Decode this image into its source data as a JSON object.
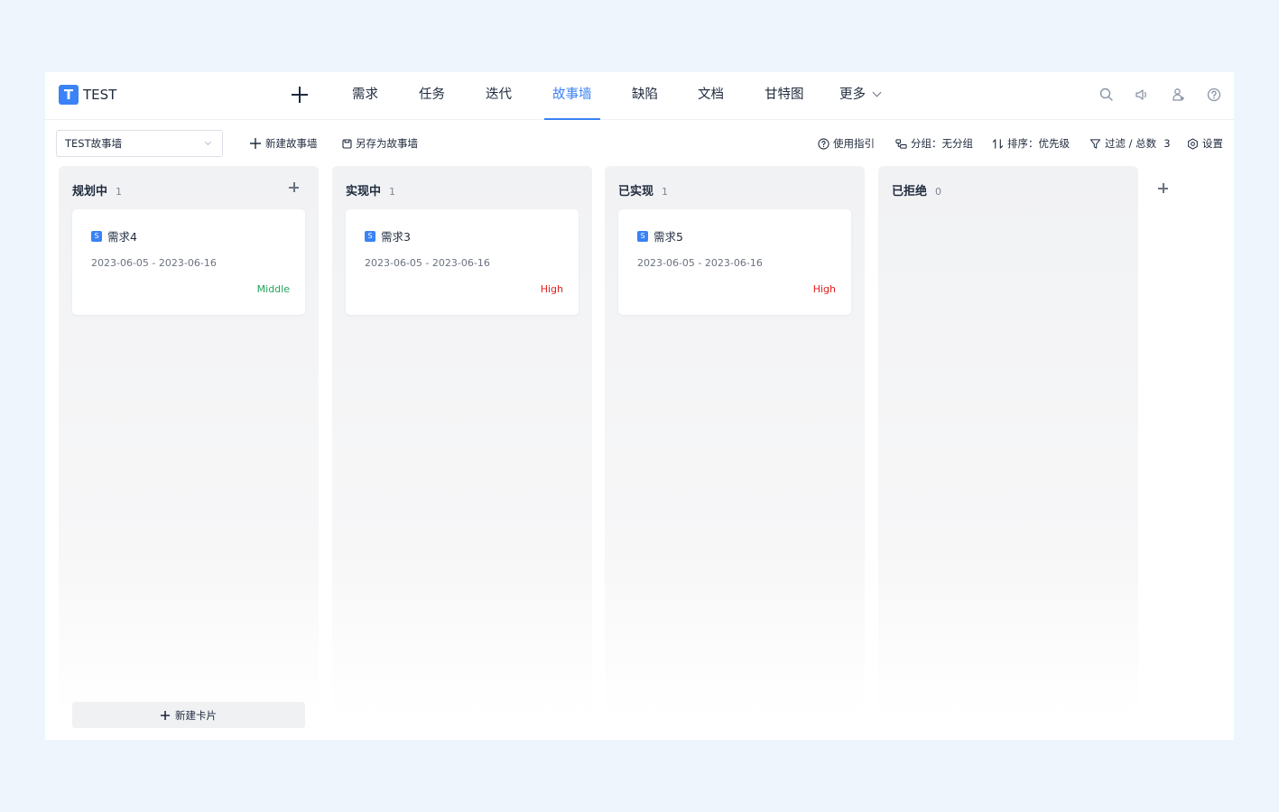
{
  "logo": {
    "letter": "T",
    "name": "TEST"
  },
  "nav": {
    "tabs": [
      {
        "label": "需求"
      },
      {
        "label": "任务"
      },
      {
        "label": "迭代"
      },
      {
        "label": "故事墙",
        "active": true
      },
      {
        "label": "缺陷"
      },
      {
        "label": "文档"
      },
      {
        "label": "甘特图"
      },
      {
        "label": "更多"
      }
    ],
    "icons": [
      "search-icon",
      "speaker-icon",
      "user-add-icon",
      "help-icon"
    ]
  },
  "toolbar": {
    "board_select": "TEST故事墙",
    "new_board": "新建故事墙",
    "save_as": "另存为故事墙",
    "guide": "使用指引",
    "group": "分组：无分组",
    "sort": "排序：优先级",
    "filter": "过滤 / 总数",
    "filter_count": "3",
    "settings": "设置"
  },
  "columns": [
    {
      "title": "规划中",
      "count": "1",
      "cards": [
        {
          "badge": "S",
          "title": "需求4",
          "dates": "2023-06-05 - 2023-06-16",
          "priority": "Middle",
          "priority_color": "#22a35a"
        }
      ]
    },
    {
      "title": "实现中",
      "count": "1",
      "cards": [
        {
          "badge": "S",
          "title": "需求3",
          "dates": "2023-06-05 - 2023-06-16",
          "priority": "High",
          "priority_color": "#e11d1d"
        }
      ]
    },
    {
      "title": "已实现",
      "count": "1",
      "cards": [
        {
          "badge": "S",
          "title": "需求5",
          "dates": "2023-06-05 - 2023-06-16",
          "priority": "High",
          "priority_color": "#e11d1d"
        }
      ]
    },
    {
      "title": "已拒绝",
      "count": "0",
      "cards": []
    }
  ],
  "new_card_label": "新建卡片",
  "colors": {
    "accent": "#3b82f6",
    "middle": "#22a35a",
    "high": "#e11d1d"
  }
}
